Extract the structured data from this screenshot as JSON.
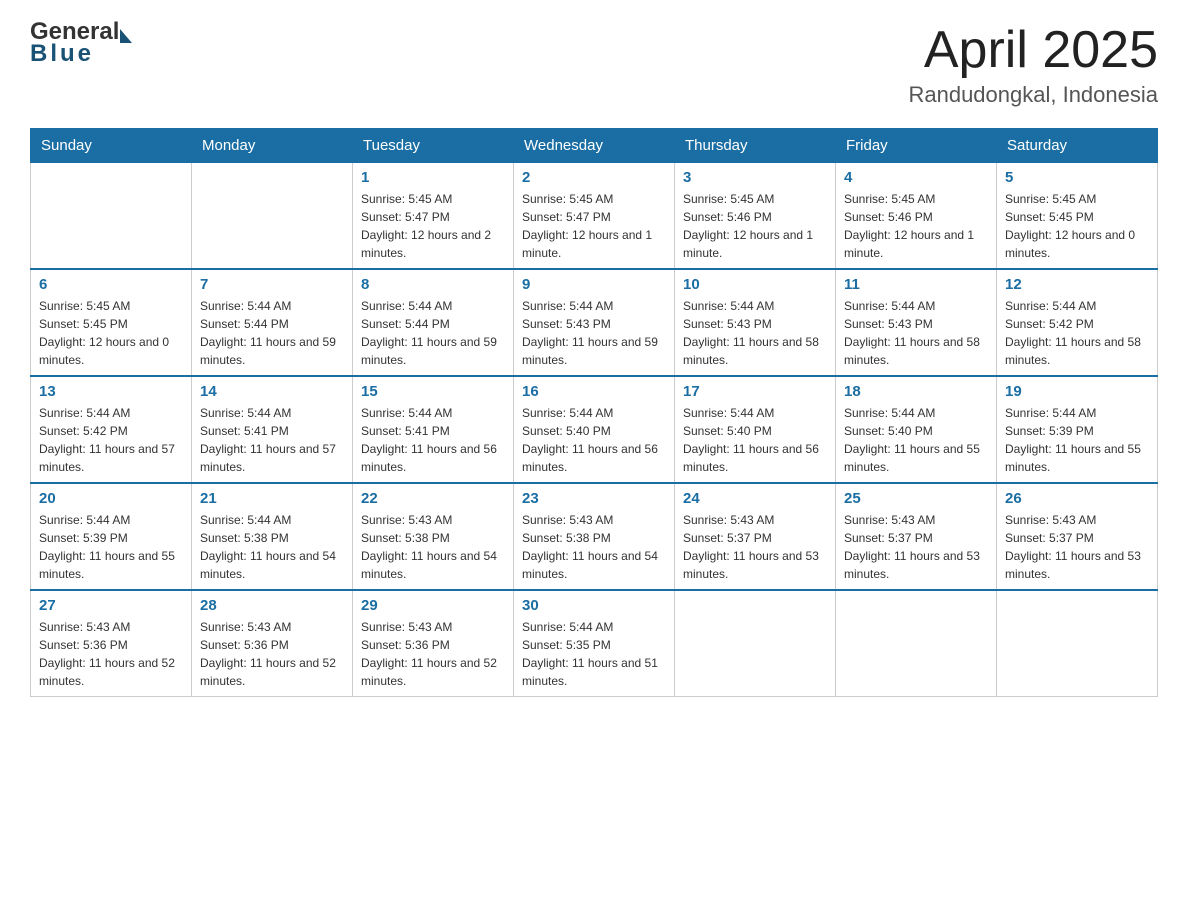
{
  "header": {
    "logo_general": "General",
    "logo_blue": "Blue",
    "month_title": "April 2025",
    "location": "Randudongkal, Indonesia"
  },
  "calendar": {
    "days_of_week": [
      "Sunday",
      "Monday",
      "Tuesday",
      "Wednesday",
      "Thursday",
      "Friday",
      "Saturday"
    ],
    "weeks": [
      [
        {
          "day": "",
          "sunrise": "",
          "sunset": "",
          "daylight": ""
        },
        {
          "day": "",
          "sunrise": "",
          "sunset": "",
          "daylight": ""
        },
        {
          "day": "1",
          "sunrise": "Sunrise: 5:45 AM",
          "sunset": "Sunset: 5:47 PM",
          "daylight": "Daylight: 12 hours and 2 minutes."
        },
        {
          "day": "2",
          "sunrise": "Sunrise: 5:45 AM",
          "sunset": "Sunset: 5:47 PM",
          "daylight": "Daylight: 12 hours and 1 minute."
        },
        {
          "day": "3",
          "sunrise": "Sunrise: 5:45 AM",
          "sunset": "Sunset: 5:46 PM",
          "daylight": "Daylight: 12 hours and 1 minute."
        },
        {
          "day": "4",
          "sunrise": "Sunrise: 5:45 AM",
          "sunset": "Sunset: 5:46 PM",
          "daylight": "Daylight: 12 hours and 1 minute."
        },
        {
          "day": "5",
          "sunrise": "Sunrise: 5:45 AM",
          "sunset": "Sunset: 5:45 PM",
          "daylight": "Daylight: 12 hours and 0 minutes."
        }
      ],
      [
        {
          "day": "6",
          "sunrise": "Sunrise: 5:45 AM",
          "sunset": "Sunset: 5:45 PM",
          "daylight": "Daylight: 12 hours and 0 minutes."
        },
        {
          "day": "7",
          "sunrise": "Sunrise: 5:44 AM",
          "sunset": "Sunset: 5:44 PM",
          "daylight": "Daylight: 11 hours and 59 minutes."
        },
        {
          "day": "8",
          "sunrise": "Sunrise: 5:44 AM",
          "sunset": "Sunset: 5:44 PM",
          "daylight": "Daylight: 11 hours and 59 minutes."
        },
        {
          "day": "9",
          "sunrise": "Sunrise: 5:44 AM",
          "sunset": "Sunset: 5:43 PM",
          "daylight": "Daylight: 11 hours and 59 minutes."
        },
        {
          "day": "10",
          "sunrise": "Sunrise: 5:44 AM",
          "sunset": "Sunset: 5:43 PM",
          "daylight": "Daylight: 11 hours and 58 minutes."
        },
        {
          "day": "11",
          "sunrise": "Sunrise: 5:44 AM",
          "sunset": "Sunset: 5:43 PM",
          "daylight": "Daylight: 11 hours and 58 minutes."
        },
        {
          "day": "12",
          "sunrise": "Sunrise: 5:44 AM",
          "sunset": "Sunset: 5:42 PM",
          "daylight": "Daylight: 11 hours and 58 minutes."
        }
      ],
      [
        {
          "day": "13",
          "sunrise": "Sunrise: 5:44 AM",
          "sunset": "Sunset: 5:42 PM",
          "daylight": "Daylight: 11 hours and 57 minutes."
        },
        {
          "day": "14",
          "sunrise": "Sunrise: 5:44 AM",
          "sunset": "Sunset: 5:41 PM",
          "daylight": "Daylight: 11 hours and 57 minutes."
        },
        {
          "day": "15",
          "sunrise": "Sunrise: 5:44 AM",
          "sunset": "Sunset: 5:41 PM",
          "daylight": "Daylight: 11 hours and 56 minutes."
        },
        {
          "day": "16",
          "sunrise": "Sunrise: 5:44 AM",
          "sunset": "Sunset: 5:40 PM",
          "daylight": "Daylight: 11 hours and 56 minutes."
        },
        {
          "day": "17",
          "sunrise": "Sunrise: 5:44 AM",
          "sunset": "Sunset: 5:40 PM",
          "daylight": "Daylight: 11 hours and 56 minutes."
        },
        {
          "day": "18",
          "sunrise": "Sunrise: 5:44 AM",
          "sunset": "Sunset: 5:40 PM",
          "daylight": "Daylight: 11 hours and 55 minutes."
        },
        {
          "day": "19",
          "sunrise": "Sunrise: 5:44 AM",
          "sunset": "Sunset: 5:39 PM",
          "daylight": "Daylight: 11 hours and 55 minutes."
        }
      ],
      [
        {
          "day": "20",
          "sunrise": "Sunrise: 5:44 AM",
          "sunset": "Sunset: 5:39 PM",
          "daylight": "Daylight: 11 hours and 55 minutes."
        },
        {
          "day": "21",
          "sunrise": "Sunrise: 5:44 AM",
          "sunset": "Sunset: 5:38 PM",
          "daylight": "Daylight: 11 hours and 54 minutes."
        },
        {
          "day": "22",
          "sunrise": "Sunrise: 5:43 AM",
          "sunset": "Sunset: 5:38 PM",
          "daylight": "Daylight: 11 hours and 54 minutes."
        },
        {
          "day": "23",
          "sunrise": "Sunrise: 5:43 AM",
          "sunset": "Sunset: 5:38 PM",
          "daylight": "Daylight: 11 hours and 54 minutes."
        },
        {
          "day": "24",
          "sunrise": "Sunrise: 5:43 AM",
          "sunset": "Sunset: 5:37 PM",
          "daylight": "Daylight: 11 hours and 53 minutes."
        },
        {
          "day": "25",
          "sunrise": "Sunrise: 5:43 AM",
          "sunset": "Sunset: 5:37 PM",
          "daylight": "Daylight: 11 hours and 53 minutes."
        },
        {
          "day": "26",
          "sunrise": "Sunrise: 5:43 AM",
          "sunset": "Sunset: 5:37 PM",
          "daylight": "Daylight: 11 hours and 53 minutes."
        }
      ],
      [
        {
          "day": "27",
          "sunrise": "Sunrise: 5:43 AM",
          "sunset": "Sunset: 5:36 PM",
          "daylight": "Daylight: 11 hours and 52 minutes."
        },
        {
          "day": "28",
          "sunrise": "Sunrise: 5:43 AM",
          "sunset": "Sunset: 5:36 PM",
          "daylight": "Daylight: 11 hours and 52 minutes."
        },
        {
          "day": "29",
          "sunrise": "Sunrise: 5:43 AM",
          "sunset": "Sunset: 5:36 PM",
          "daylight": "Daylight: 11 hours and 52 minutes."
        },
        {
          "day": "30",
          "sunrise": "Sunrise: 5:44 AM",
          "sunset": "Sunset: 5:35 PM",
          "daylight": "Daylight: 11 hours and 51 minutes."
        },
        {
          "day": "",
          "sunrise": "",
          "sunset": "",
          "daylight": ""
        },
        {
          "day": "",
          "sunrise": "",
          "sunset": "",
          "daylight": ""
        },
        {
          "day": "",
          "sunrise": "",
          "sunset": "",
          "daylight": ""
        }
      ]
    ]
  }
}
